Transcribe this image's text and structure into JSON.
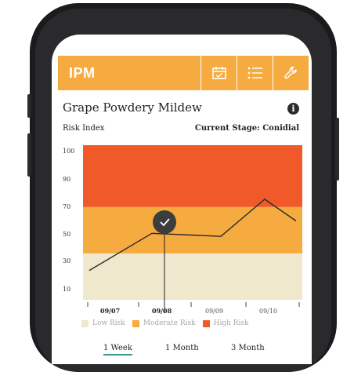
{
  "app": {
    "title": "IPM"
  },
  "header_icons": [
    "calendar-icon",
    "list-icon",
    "wrench-icon"
  ],
  "page": {
    "title": "Grape Powdery Mildew",
    "info_icon": "i",
    "risk_index_label": "Risk Index",
    "current_stage": "Current Stage: Conidial"
  },
  "colors": {
    "accent": "#f5ab3f",
    "high_risk": "#f05a28",
    "moderate_risk": "#f5ab3f",
    "low_risk": "#efe8cd",
    "active_tab": "#3a9d8f"
  },
  "chart_data": {
    "type": "line",
    "y_ticks": [
      "100",
      "90",
      "70",
      "50",
      "30",
      "10"
    ],
    "x_tick_labels": [
      "09/07",
      "09/08",
      "09/09",
      "09/10"
    ],
    "selected_date": "09/08",
    "zones": [
      {
        "name": "Low Risk",
        "from": 0,
        "to": 30
      },
      {
        "name": "Moderate Risk",
        "from": 30,
        "to": 60
      },
      {
        "name": "High Risk",
        "from": 60,
        "to": 100
      }
    ],
    "series": [
      {
        "values": [
          {
            "x": 6.6,
            "y": 19
          },
          {
            "x": 7.6,
            "y": 43
          },
          {
            "x": 8.7,
            "y": 41
          },
          {
            "x": 9.4,
            "y": 65
          },
          {
            "x": 9.9,
            "y": 51
          }
        ]
      }
    ],
    "ylim": [
      0,
      100
    ],
    "xlim": [
      6.5,
      10
    ]
  },
  "legend": [
    "Low Risk",
    "Moderate Risk",
    "High Risk"
  ],
  "time_ranges": [
    "1 Week",
    "1 Month",
    "3 Month"
  ],
  "active_range": "1 Week"
}
